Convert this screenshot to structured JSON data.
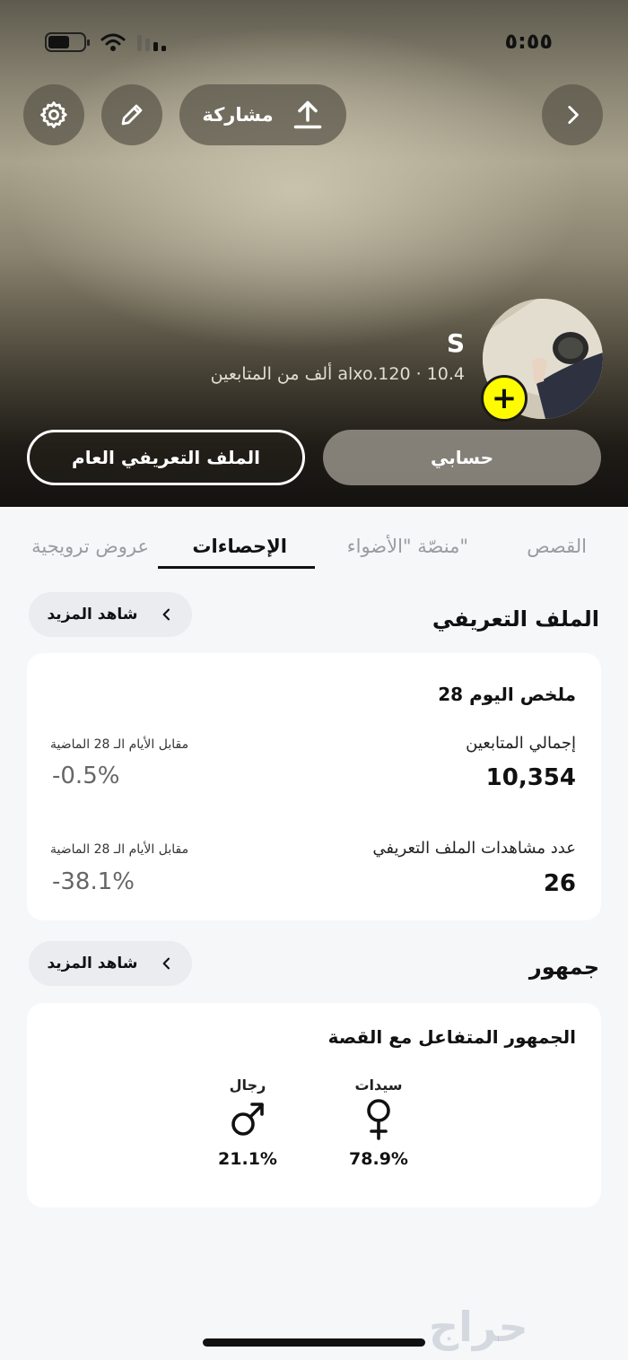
{
  "status_bar": {
    "time": "٥:٥٥"
  },
  "header": {
    "share_label": "مشاركة",
    "icons": [
      "gear-icon",
      "pencil-icon",
      "upload-icon",
      "chevron-right-icon"
    ],
    "display_name": "S",
    "username": "alxo.120",
    "followers_text": "10.4 ألف من المتابعين",
    "separator": "·",
    "public_profile_label": "الملف التعريفي العام",
    "my_account_label": "حسابي",
    "add_badge": "+",
    "badge_color": "#fffc00"
  },
  "tabs": [
    {
      "label": "القصص",
      "active": false
    },
    {
      "label": "منصّة \"الأضواء\"",
      "active": false
    },
    {
      "label": "الإحصاءات",
      "active": true
    },
    {
      "label": "عروض ترويجية",
      "active": false
    }
  ],
  "profile_section": {
    "title": "الملف التعريفي",
    "see_more_label": "شاهد المزيد",
    "card_title": "28 ملخص اليوم",
    "stats": [
      {
        "label": "إجمالي المتابعين",
        "value": "10,354",
        "compare_label": "مقابل الأيام الـ 28 الماضية",
        "compare_value": "-0.5%"
      },
      {
        "label": "عدد مشاهدات الملف التعريفي",
        "value": "26",
        "compare_label": "مقابل الأيام الـ 28 الماضية",
        "compare_value": "-38.1%"
      }
    ]
  },
  "audience_section": {
    "title": "جمهور",
    "see_more_label": "شاهد المزيد",
    "card_title": "الجمهور المتفاعل مع القصة",
    "female": {
      "label": "سيدات",
      "percent": "78.9%"
    },
    "male": {
      "label": "رجال",
      "percent": "21.1%"
    }
  },
  "watermark": "حراج"
}
